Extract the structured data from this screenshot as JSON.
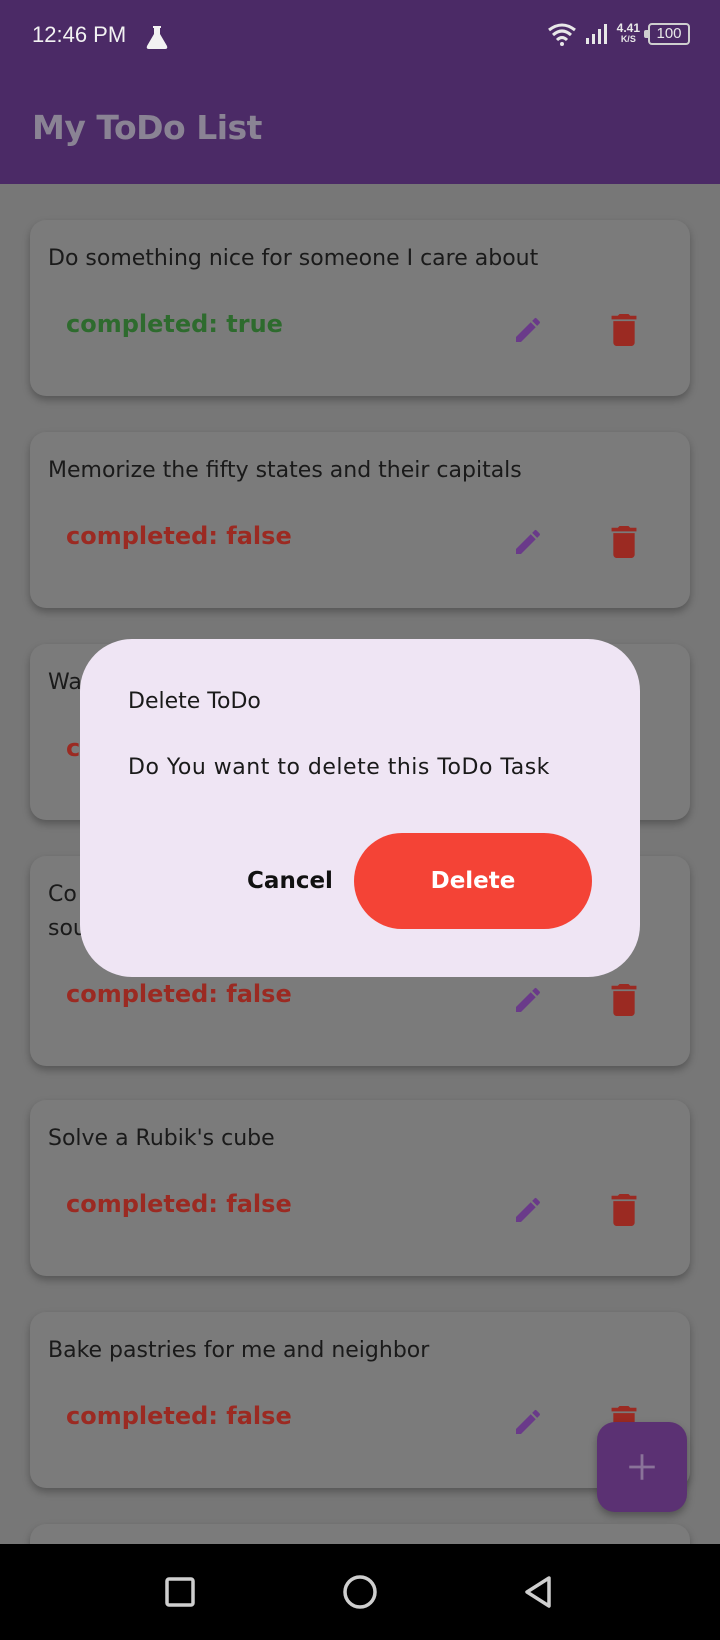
{
  "status_bar": {
    "time": "12:46 PM",
    "speed_top": "4.41",
    "speed_unit": "K/S",
    "battery": "100",
    "icons": [
      "flask-icon",
      "wifi-icon",
      "signal-icon",
      "battery-icon"
    ]
  },
  "app_bar": {
    "title": "My ToDo List"
  },
  "todos": [
    {
      "title": "Do something nice for someone I care about",
      "status": "completed: true"
    },
    {
      "title": "Memorize the fifty states and their capitals",
      "status": "completed: false"
    },
    {
      "title": "Wa",
      "status": "c"
    },
    {
      "title": "Co\nsou",
      "status": "completed: false"
    },
    {
      "title": "Solve a Rubik's cube",
      "status": "completed: false"
    },
    {
      "title": "Bake pastries for me and neighbor",
      "status": "completed: false"
    }
  ],
  "dialog": {
    "title": "Delete ToDo",
    "message": "Do You want to delete this ToDo Task",
    "cancel_label": "Cancel",
    "delete_label": "Delete"
  },
  "colors": {
    "app_bar": "#4b2a66",
    "completed_true": "#2e6b2e",
    "completed_false": "#9b2a22",
    "edit_icon": "#6a3a8a",
    "delete_icon": "#9b2a22",
    "dialog_bg": "#efe5f4",
    "delete_button": "#f44336"
  },
  "fab_icon": "plus-icon",
  "nav_icons": [
    "recents-square-icon",
    "home-circle-icon",
    "back-triangle-icon"
  ]
}
